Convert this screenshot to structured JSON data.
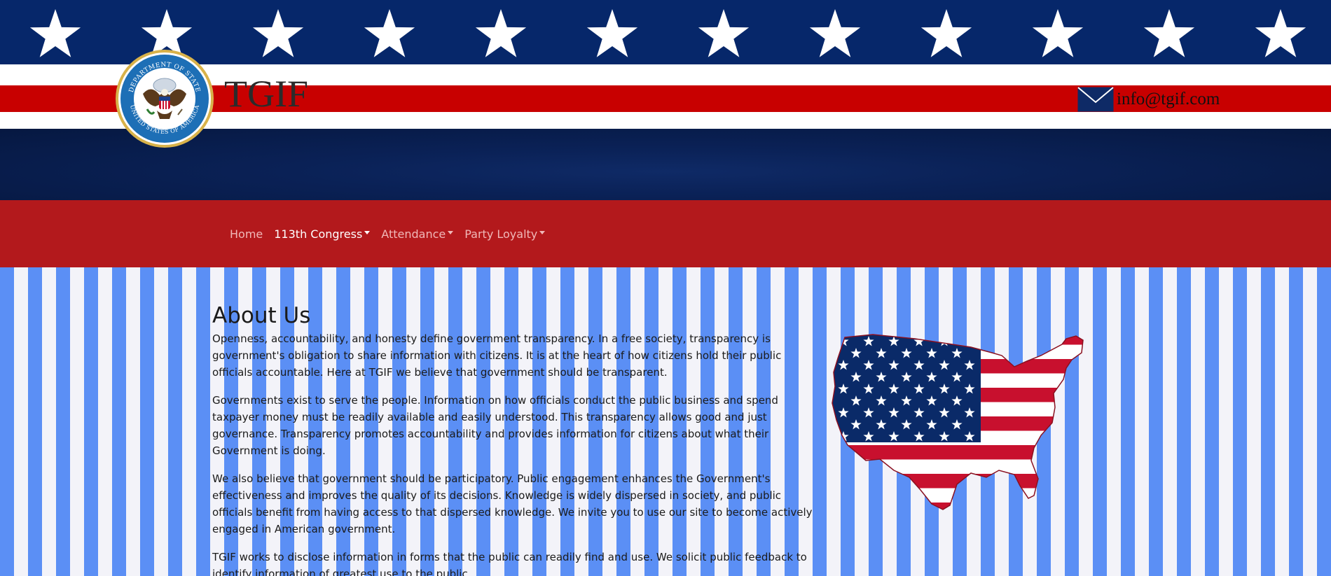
{
  "header": {
    "site_title": "TGIF",
    "email": "info@tgif.com",
    "seal_top_text": "DEPARTMENT OF STATE",
    "seal_bottom_text": "UNITED STATES OF AMERICA"
  },
  "nav": {
    "items": [
      {
        "label": "Home",
        "dropdown": false,
        "active": false
      },
      {
        "label": "113th Congress",
        "dropdown": true,
        "active": true
      },
      {
        "label": "Attendance",
        "dropdown": true,
        "active": false
      },
      {
        "label": "Party Loyalty",
        "dropdown": true,
        "active": false
      }
    ]
  },
  "about": {
    "heading": "About Us",
    "paragraphs": [
      "Openness, accountability, and honesty define government transparency. In a free society, transparency is government's obligation to share information with citizens. It is at the heart of how citizens hold their public officials accountable. Here at TGIF we believe that government should be transparent.",
      "Governments exist to serve the people. Information on how officials conduct the public business and spend taxpayer money must be readily available and easily understood. This transparency allows good and just governance. Transparency promotes accountability and provides information for citizens about what their Government is doing.",
      "We also believe that government should be participatory. Public engagement enhances the Government's effectiveness and improves the quality of its decisions. Knowledge is widely dispersed in society, and public officials benefit from having access to that dispersed knowledge. We invite you to use our site to become actively engaged in American government.",
      "TGIF works to disclose information in forms that the public can readily find and use. We solicit public feedback to identify information of greatest use to the public."
    ]
  },
  "colors": {
    "header_blue": "#06276a",
    "flag_red": "#c80000",
    "navbar_red": "#b3191c",
    "stripe_blue": "#5b8ff5"
  },
  "icons": {
    "envelope": "envelope-icon",
    "seal": "department-of-state-seal",
    "map": "usa-flag-map"
  }
}
